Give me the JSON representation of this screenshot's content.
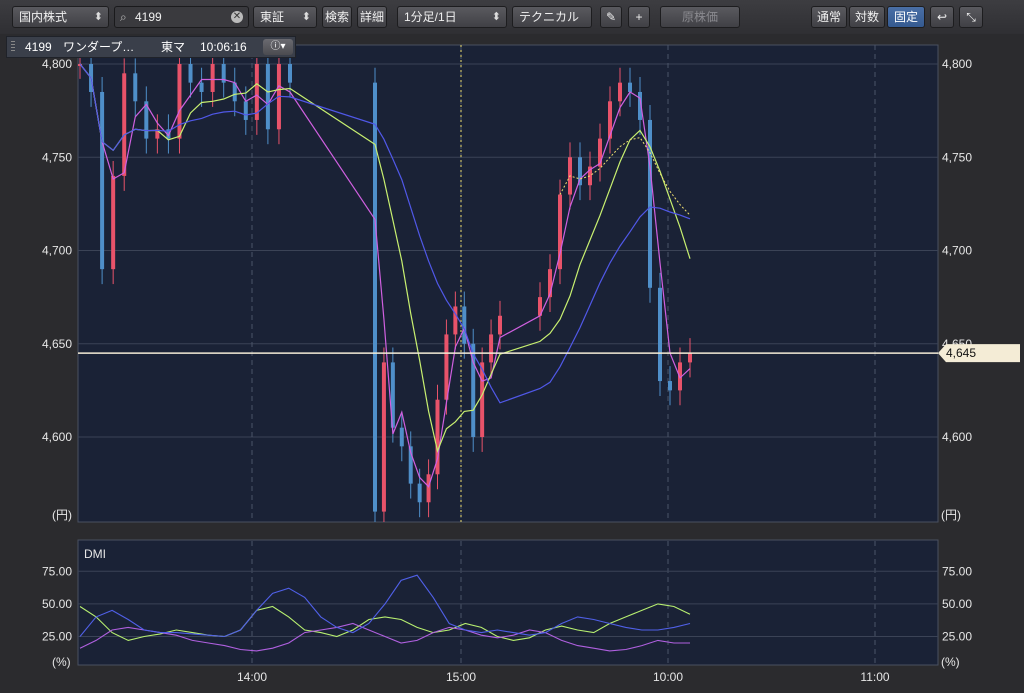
{
  "toolbar": {
    "market_select": "国内株式",
    "search_value": "4199",
    "exchange_select": "東証",
    "search_button": "検索",
    "detail_button": "詳細",
    "interval_select": "1分足/1日",
    "technical_button": "テクニカル",
    "original_price_button": "原株価",
    "scale_normal": "通常",
    "scale_log": "対数",
    "scale_fixed": "固定",
    "undo_icon": "undo-icon",
    "expand_icon": "collapse-icon"
  },
  "info_bar": {
    "code": "4199",
    "name": "ワンダープ…",
    "market": "東マ",
    "time": "10:06:16"
  },
  "colors": {
    "up": "#e8536a",
    "down": "#4f8fc9",
    "ma_short": "#d060e0",
    "ma_mid": "#c8f070",
    "ma_long": "#5058e8",
    "vwap": "#f0e070",
    "dmi_plus": "#b8f070",
    "dmi_minus": "#b060e0",
    "adx": "#5060e8",
    "background": "#1a2236"
  },
  "chart_data": [
    {
      "type": "candlestick",
      "unit_label": "(円)",
      "y_ticks": [
        "4,800",
        "4,750",
        "4,700",
        "4,650",
        "4,600"
      ],
      "ylim": [
        4575,
        4800
      ],
      "x_ticks": [
        "14:00",
        "15:00",
        "10:00",
        "11:00"
      ],
      "current_price_label": "4,645",
      "current_price": 4645,
      "grid": true,
      "series": [
        {
          "name": "",
          "values": [
            4800,
            4785,
            4690,
            4740,
            4795,
            4780,
            4760,
            4765,
            4760,
            4800,
            4790,
            4785,
            4800,
            4790,
            4780,
            4770,
            4800,
            4765,
            4800,
            4790,
            4560,
            4640,
            4605,
            4595,
            4575,
            4565,
            4580,
            4620,
            4655,
            4670,
            4650,
            4600,
            4640,
            4655,
            4665,
            4675,
            4690,
            4730,
            4750,
            4735,
            4745,
            4760,
            4780,
            4790,
            4785,
            4770,
            4680,
            4630,
            4625,
            4640,
            4645
          ]
        }
      ]
    },
    {
      "type": "line",
      "title": "DMI",
      "unit_label": "(%)",
      "y_ticks": [
        "75.00",
        "50.00",
        "25.00"
      ],
      "ylim": [
        5,
        80
      ],
      "x_ticks": [
        "14:00",
        "15:00",
        "10:00",
        "11:00"
      ],
      "series": [
        {
          "name": "",
          "values": [
            48,
            40,
            28,
            22,
            25,
            27,
            30,
            28,
            26,
            25,
            30,
            45,
            48,
            40,
            30,
            28,
            25,
            30,
            38,
            40,
            38,
            32,
            28,
            30,
            35,
            32,
            25,
            22,
            24,
            30,
            33,
            30,
            28,
            35,
            40,
            45,
            50,
            48,
            42
          ]
        },
        {
          "name": "",
          "values": [
            16,
            22,
            30,
            32,
            30,
            28,
            26,
            22,
            20,
            18,
            15,
            14,
            16,
            20,
            28,
            30,
            32,
            35,
            30,
            25,
            20,
            22,
            28,
            32,
            30,
            26,
            24,
            26,
            30,
            28,
            22,
            18,
            16,
            14,
            15,
            18,
            22,
            20,
            20
          ]
        },
        {
          "name": "",
          "values": [
            25,
            40,
            45,
            38,
            30,
            28,
            28,
            27,
            26,
            25,
            30,
            45,
            58,
            62,
            55,
            40,
            32,
            28,
            35,
            50,
            68,
            72,
            55,
            35,
            30,
            28,
            30,
            28,
            26,
            28,
            35,
            40,
            38,
            35,
            32,
            30,
            30,
            32,
            35
          ]
        }
      ]
    }
  ]
}
